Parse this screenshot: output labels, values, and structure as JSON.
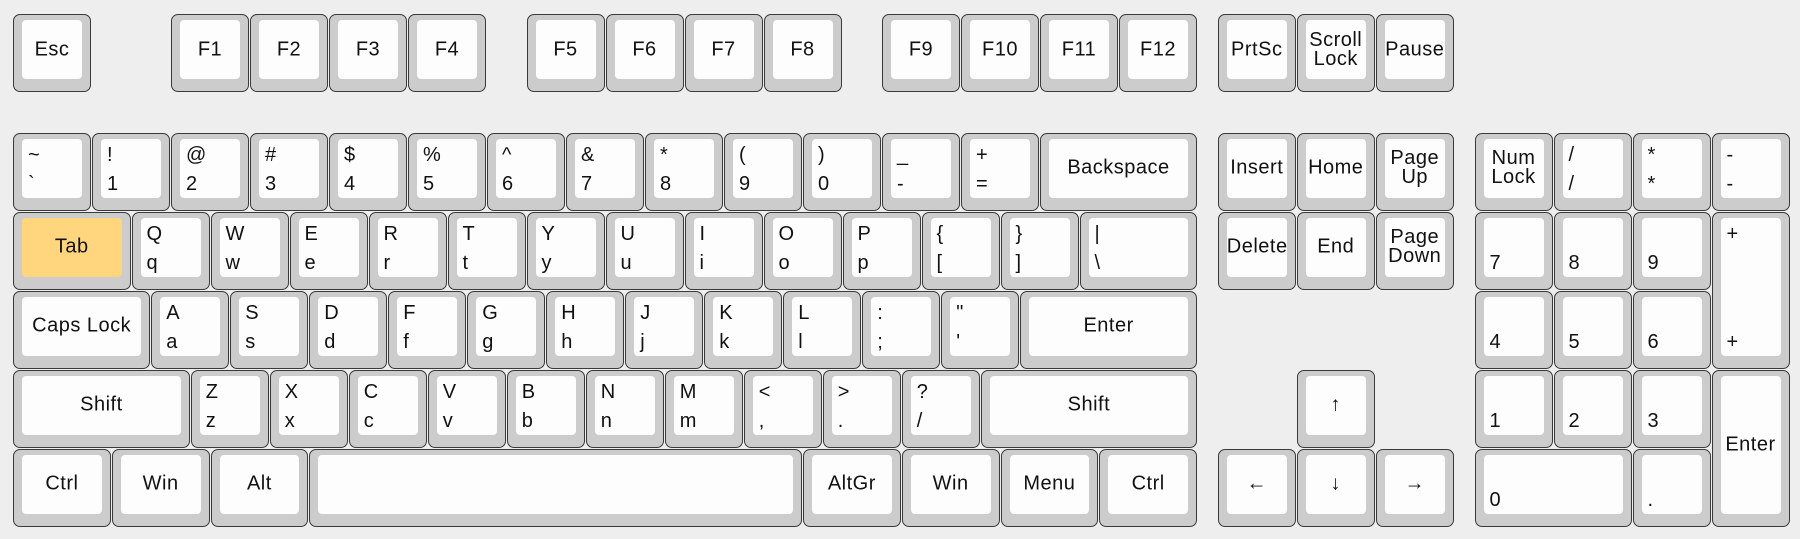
{
  "colors": {
    "background": "#eeeeee",
    "key_base": "#cccccc",
    "key_cap": "#fdfdfd",
    "highlight": "#ffd67e",
    "border": "#3a3a3a"
  },
  "highlighted_key": "Tab",
  "keys": [
    {
      "label": "Esc"
    },
    {
      "label": "F1"
    },
    {
      "label": "F2"
    },
    {
      "label": "F3"
    },
    {
      "label": "F4"
    },
    {
      "label": "F5"
    },
    {
      "label": "F6"
    },
    {
      "label": "F7"
    },
    {
      "label": "F8"
    },
    {
      "label": "F9"
    },
    {
      "label": "F10"
    },
    {
      "label": "F11"
    },
    {
      "label": "F12"
    },
    {
      "label": "PrtSc"
    },
    {
      "label": "Scroll\nLock"
    },
    {
      "label": "Pause"
    },
    {
      "top": "~",
      "bottom": "`"
    },
    {
      "top": "!",
      "bottom": "1"
    },
    {
      "top": "@",
      "bottom": "2"
    },
    {
      "top": "#",
      "bottom": "3"
    },
    {
      "top": "$",
      "bottom": "4"
    },
    {
      "top": "%",
      "bottom": "5"
    },
    {
      "top": "^",
      "bottom": "6"
    },
    {
      "top": "&",
      "bottom": "7"
    },
    {
      "top": "*",
      "bottom": "8"
    },
    {
      "top": "(",
      "bottom": "9"
    },
    {
      "top": ")",
      "bottom": "0"
    },
    {
      "top": "_",
      "bottom": "-"
    },
    {
      "top": "+",
      "bottom": "="
    },
    {
      "label": "Backspace"
    },
    {
      "label": "Insert"
    },
    {
      "label": "Home"
    },
    {
      "label": "Page\nUp"
    },
    {
      "label": "Num\nLock"
    },
    {
      "top": "/",
      "bottom": "/"
    },
    {
      "top": "*",
      "bottom": "*"
    },
    {
      "top": "-",
      "bottom": "-"
    },
    {
      "label": "Tab"
    },
    {
      "top": "Q",
      "bottom": "q"
    },
    {
      "top": "W",
      "bottom": "w"
    },
    {
      "top": "E",
      "bottom": "e"
    },
    {
      "top": "R",
      "bottom": "r"
    },
    {
      "top": "T",
      "bottom": "t"
    },
    {
      "top": "Y",
      "bottom": "y"
    },
    {
      "top": "U",
      "bottom": "u"
    },
    {
      "top": "I",
      "bottom": "i"
    },
    {
      "top": "O",
      "bottom": "o"
    },
    {
      "top": "P",
      "bottom": "p"
    },
    {
      "top": "{",
      "bottom": "["
    },
    {
      "top": "}",
      "bottom": "]"
    },
    {
      "top": "|",
      "bottom": "\\"
    },
    {
      "label": "Delete"
    },
    {
      "label": "End"
    },
    {
      "label": "Page\nDown"
    },
    {
      "bottom": "7"
    },
    {
      "bottom": "8"
    },
    {
      "bottom": "9"
    },
    {
      "top": "+",
      "bottom": "+"
    },
    {
      "label": "Caps Lock"
    },
    {
      "top": "A",
      "bottom": "a"
    },
    {
      "top": "S",
      "bottom": "s"
    },
    {
      "top": "D",
      "bottom": "d"
    },
    {
      "top": "F",
      "bottom": "f"
    },
    {
      "top": "G",
      "bottom": "g"
    },
    {
      "top": "H",
      "bottom": "h"
    },
    {
      "top": "J",
      "bottom": "j"
    },
    {
      "top": "K",
      "bottom": "k"
    },
    {
      "top": "L",
      "bottom": "l"
    },
    {
      "top": ":",
      "bottom": ";"
    },
    {
      "top": "\"",
      "bottom": "'"
    },
    {
      "label": "Enter"
    },
    {
      "bottom": "4"
    },
    {
      "bottom": "5"
    },
    {
      "bottom": "6"
    },
    {
      "label": "Shift"
    },
    {
      "top": "Z",
      "bottom": "z"
    },
    {
      "top": "X",
      "bottom": "x"
    },
    {
      "top": "C",
      "bottom": "c"
    },
    {
      "top": "V",
      "bottom": "v"
    },
    {
      "top": "B",
      "bottom": "b"
    },
    {
      "top": "N",
      "bottom": "n"
    },
    {
      "top": "M",
      "bottom": "m"
    },
    {
      "top": "<",
      "bottom": ","
    },
    {
      "top": ">",
      "bottom": "."
    },
    {
      "top": "?",
      "bottom": "/"
    },
    {
      "label": "Shift"
    },
    {
      "label": "↑"
    },
    {
      "bottom": "1"
    },
    {
      "bottom": "2"
    },
    {
      "bottom": "3"
    },
    {
      "label": "Enter"
    },
    {
      "label": "Ctrl"
    },
    {
      "label": "Win"
    },
    {
      "label": "Alt"
    },
    {
      "label": ""
    },
    {
      "label": "AltGr"
    },
    {
      "label": "Win"
    },
    {
      "label": "Menu"
    },
    {
      "label": "Ctrl"
    },
    {
      "label": "←"
    },
    {
      "label": "↓"
    },
    {
      "label": "→"
    },
    {
      "bottom": "0"
    },
    {
      "bottom": "."
    }
  ]
}
